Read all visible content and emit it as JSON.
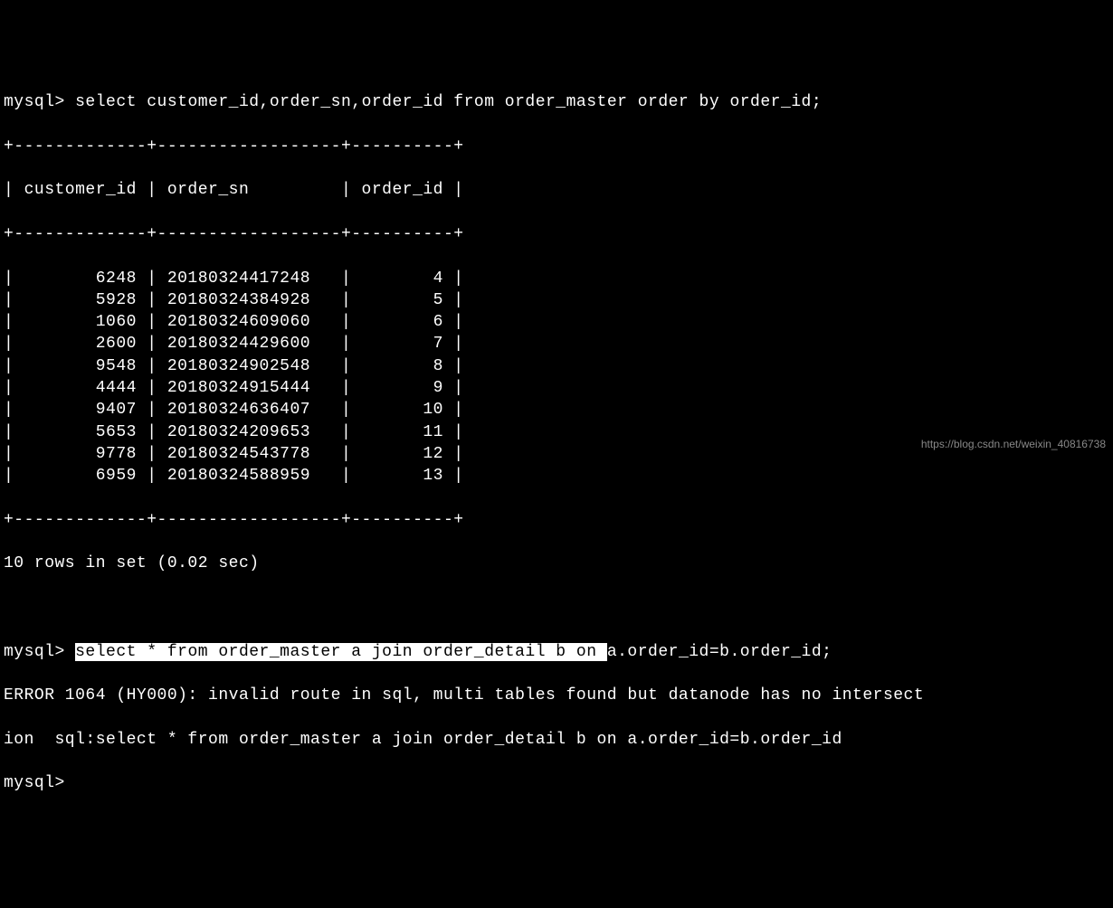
{
  "prompt": "mysql>",
  "query1": "select customer_id,order_sn,order_id from order_master order by order_id;",
  "table": {
    "border_top": "+-------------+------------------+----------+",
    "header_row": "| customer_id | order_sn         | order_id |",
    "border_mid": "+-------------+------------------+----------+",
    "rows": [
      {
        "customer_id": "6248",
        "order_sn": "20180324417248",
        "order_id": "4"
      },
      {
        "customer_id": "5928",
        "order_sn": "20180324384928",
        "order_id": "5"
      },
      {
        "customer_id": "1060",
        "order_sn": "20180324609060",
        "order_id": "6"
      },
      {
        "customer_id": "2600",
        "order_sn": "20180324429600",
        "order_id": "7"
      },
      {
        "customer_id": "9548",
        "order_sn": "20180324902548",
        "order_id": "8"
      },
      {
        "customer_id": "4444",
        "order_sn": "20180324915444",
        "order_id": "9"
      },
      {
        "customer_id": "9407",
        "order_sn": "20180324636407",
        "order_id": "10"
      },
      {
        "customer_id": "5653",
        "order_sn": "20180324209653",
        "order_id": "11"
      },
      {
        "customer_id": "9778",
        "order_sn": "20180324543778",
        "order_id": "12"
      },
      {
        "customer_id": "6959",
        "order_sn": "20180324588959",
        "order_id": "13"
      }
    ],
    "border_bot": "+-------------+------------------+----------+"
  },
  "result_summary": "10 rows in set (0.02 sec)",
  "query2_highlight": "select * from order_master a join order_detail b on ",
  "query2_rest": "a.order_id=b.order_id;",
  "error_line1": "ERROR 1064 (HY000): invalid route in sql, multi tables found but datanode has no intersect",
  "error_line2": "ion  sql:select * from order_master a join order_detail b on a.order_id=b.order_id",
  "watermark": "https://blog.csdn.net/weixin_40816738"
}
